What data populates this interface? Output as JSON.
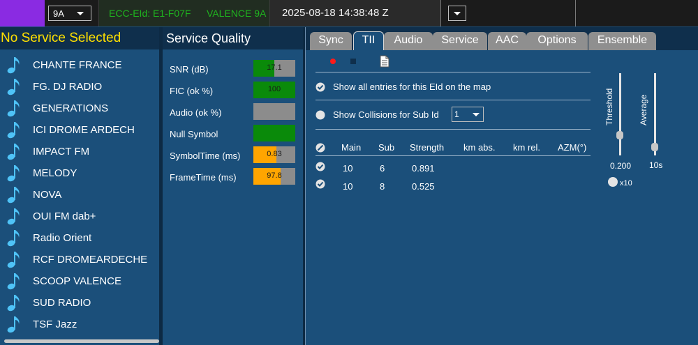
{
  "topbar": {
    "channel": "9A",
    "ecc": "ECC-EId: E1-F07F",
    "ensemble_label": "VALENCE 9A",
    "datetime": "2025-08-18  14:38:48 Z"
  },
  "services": {
    "header": "No Service Selected",
    "items": [
      {
        "label": "CHANTE FRANCE",
        "icon": "music-note-icon"
      },
      {
        "label": "FG. DJ RADIO",
        "icon": "music-note-icon"
      },
      {
        "label": "GENERATIONS",
        "icon": "music-note-icon"
      },
      {
        "label": "ICI DROME ARDECH",
        "icon": "music-note-icon"
      },
      {
        "label": "IMPACT FM",
        "icon": "music-note-icon"
      },
      {
        "label": "MELODY",
        "icon": "music-note-icon"
      },
      {
        "label": "NOVA",
        "icon": "music-note-icon"
      },
      {
        "label": "OUI FM dab+",
        "icon": "music-note-icon"
      },
      {
        "label": "Radio Orient",
        "icon": "music-note-icon"
      },
      {
        "label": "RCF DROMEARDECHE",
        "icon": "music-note-icon"
      },
      {
        "label": "SCOOP VALENCE",
        "icon": "music-note-icon"
      },
      {
        "label": "SUD RADIO",
        "icon": "music-note-icon"
      },
      {
        "label": "TSF Jazz",
        "icon": "music-note-icon"
      }
    ]
  },
  "quality": {
    "header": "Service Quality",
    "rows": [
      {
        "label": "SNR (dB)",
        "value": "17.1",
        "fill_fraction": 0.5,
        "color": "#0a8a0a"
      },
      {
        "label": "FIC (ok %)",
        "value": "100",
        "fill_fraction": 1.0,
        "color": "#0a8a0a"
      },
      {
        "label": "Audio (ok %)",
        "value": "",
        "fill_fraction": 0.0,
        "color": "#0a8a0a"
      },
      {
        "label": "Null Symbol",
        "value": "",
        "fill_fraction": 1.0,
        "color": "#0a8a0a"
      },
      {
        "label": "SymbolTime (ms)",
        "value": "0.83",
        "fill_fraction": 0.55,
        "color": "#ffa500"
      },
      {
        "label": "FrameTime (ms)",
        "value": "97.8",
        "fill_fraction": 0.65,
        "color": "#ffa500"
      }
    ]
  },
  "tabs": {
    "items": [
      "Sync",
      "TII",
      "Audio",
      "Service",
      "AAC",
      "Options",
      "Ensemble"
    ],
    "active": "TII"
  },
  "tii": {
    "toolbar": {
      "record_icon": "record-icon",
      "stop_icon": "stop-icon",
      "document_icon": "document-icon"
    },
    "show_all_label": "Show all entries for this EId on the map",
    "show_all_checked": true,
    "collisions_label": "Show Collisions for Sub Id",
    "collisions_checked": false,
    "sub_id_value": "1",
    "table": {
      "columns": [
        "Main",
        "Sub",
        "Strength",
        "km abs.",
        "km rel.",
        "AZM(°)"
      ],
      "rows": [
        {
          "main": "10",
          "sub": "6",
          "strength": "0.891",
          "km_abs": "",
          "km_rel": "",
          "azm": ""
        },
        {
          "main": "10",
          "sub": "8",
          "strength": "0.525",
          "km_abs": "",
          "km_rel": "",
          "azm": ""
        }
      ]
    },
    "threshold": {
      "label": "Threshold",
      "value": "0.200",
      "level": 0.25
    },
    "average": {
      "label": "Average",
      "value": "10s",
      "level": 0.1
    },
    "x10_label": "x10"
  },
  "colors": {
    "panel_blue": "#1b4f7a",
    "header_dark": "#0f2f4c",
    "accent_yellow": "#ffe000",
    "ecc_green": "#1fb41f",
    "bar_green": "#0a8a0a",
    "bar_orange": "#ffa500"
  }
}
